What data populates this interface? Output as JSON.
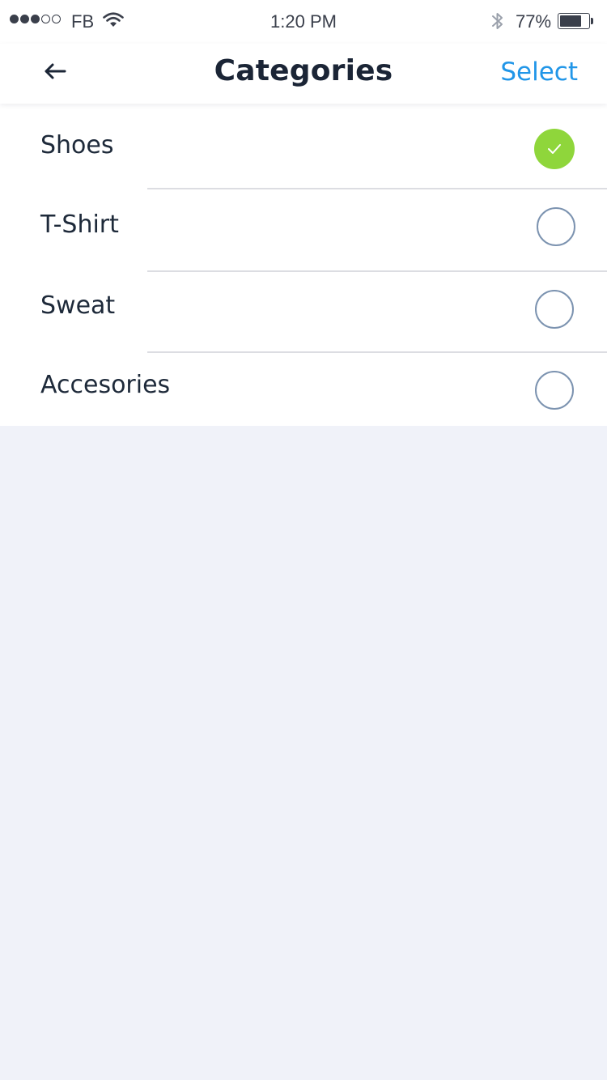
{
  "status_bar": {
    "carrier": "FB",
    "time": "1:20 PM",
    "battery_percent": "77%",
    "battery_level": 0.77,
    "signal_bars_filled": 3,
    "signal_bars_total": 5
  },
  "nav": {
    "title": "Categories",
    "select_label": "Select",
    "back_icon": "arrow-left-icon"
  },
  "categories": [
    {
      "label": "Shoes",
      "selected": true
    },
    {
      "label": "T-Shirt",
      "selected": false
    },
    {
      "label": "Sweat",
      "selected": false
    },
    {
      "label": "Accesories",
      "selected": false
    }
  ],
  "colors": {
    "accent": "#2196e8",
    "selected": "#8fd63b",
    "radio_border": "#7c93b0",
    "background": "#f0f2f9"
  }
}
